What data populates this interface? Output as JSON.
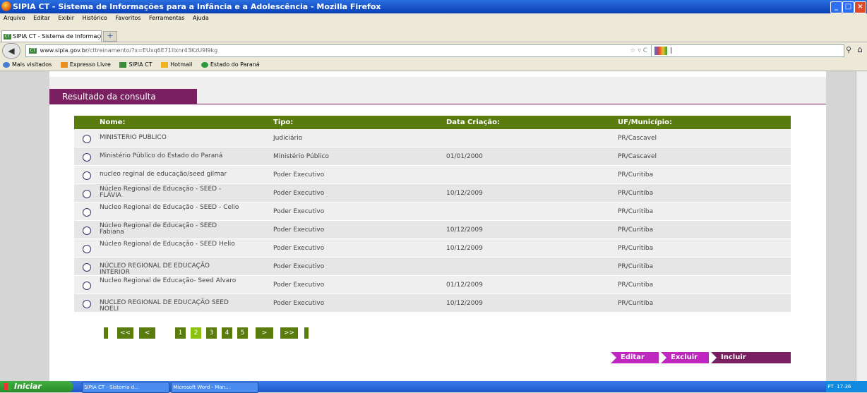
{
  "window": {
    "title": "SIPIA CT - Sistema de Informações para a Infância e a Adolescência - Mozilla Firefox"
  },
  "menu": [
    "Arquivo",
    "Editar",
    "Exibir",
    "Histórico",
    "Favoritos",
    "Ferramentas",
    "Ajuda"
  ],
  "tab": {
    "label": "SIPIA CT - Sistema de Informações para a I...",
    "new_tab": "+"
  },
  "nav": {
    "url_host": "www.sipia.gov.br",
    "url_path": "/cttreinamento/?x=EUxq6E71lIxnr43KzU9l9kg",
    "search_value": "|"
  },
  "bookmarks": [
    "Mais visitados",
    "Expresso Livre",
    "SIPIA CT",
    "Hotmail",
    "Estado do Paraná"
  ],
  "section_title": "Resultado da consulta",
  "table": {
    "headers": {
      "nome": "Nome:",
      "tipo": "Tipo:",
      "data": "Data Criação:",
      "uf": "UF/Município:"
    },
    "rows": [
      {
        "nome": "MINISTERIO PUBLICO",
        "tipo": "Judiciário",
        "data": "",
        "uf": "PR/Cascavel"
      },
      {
        "nome": "Ministério Público do Estado do Paraná",
        "tipo": "Ministério Público",
        "data": "01/01/2000",
        "uf": "PR/Cascavel"
      },
      {
        "nome": "nucleo reginal de educação/seed gilmar",
        "tipo": "Poder Executivo",
        "data": "",
        "uf": "PR/Curitiba"
      },
      {
        "nome": "Núcleo Regional de Educação - SEED - FLÁVIA",
        "tipo": "Poder Executivo",
        "data": "10/12/2009",
        "uf": "PR/Curitiba"
      },
      {
        "nome": "Nucleo Regional de Educação - SEED - Celio",
        "tipo": "Poder Executivo",
        "data": "",
        "uf": "PR/Curitiba"
      },
      {
        "nome": "Núcleo Regional de Educação - SEED Fabiana",
        "tipo": "Poder Executivo",
        "data": "10/12/2009",
        "uf": "PR/Curitiba"
      },
      {
        "nome": "Núcleo Regional de Educação - SEED Helio",
        "tipo": "Poder Executivo",
        "data": "10/12/2009",
        "uf": "PR/Curitiba"
      },
      {
        "nome": "NÚCLEO REGIONAL DE EDUCAÇÃO INTERIOR",
        "tipo": "Poder Executivo",
        "data": "",
        "uf": "PR/Curitiba"
      },
      {
        "nome": "Nucleo Regional de Educação- Seed Alvaro",
        "tipo": "Poder Executivo",
        "data": "01/12/2009",
        "uf": "PR/Curitiba"
      },
      {
        "nome": "NUCLEO REGIONAL DE EDUCAÇÃO SEED NOELI",
        "tipo": "Poder Executivo",
        "data": "10/12/2009",
        "uf": "PR/Curitiba"
      }
    ]
  },
  "pagination": {
    "first": "<<",
    "prev": "<",
    "pages": [
      "1",
      "2",
      "3",
      "4",
      "5"
    ],
    "current": "2",
    "next": ">",
    "last": ">>"
  },
  "actions": {
    "edit": "Editar",
    "delete": "Excluir",
    "add": "Incluir"
  },
  "taskbar": {
    "start": "Iniciar",
    "items": [
      "SIPIA CT - Sistema d...",
      "Microsoft Word - Man..."
    ],
    "lang": "PT",
    "clock": "17:36"
  },
  "colors": {
    "accent_purple": "#7a1f5f",
    "header_green": "#5a7b0e",
    "page_selected": "#8cc20e",
    "action_magenta": "#c026c0"
  }
}
